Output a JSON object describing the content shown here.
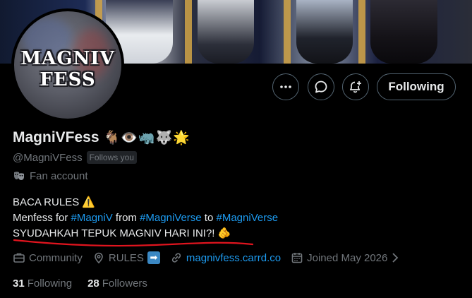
{
  "profile": {
    "avatar_text_line1": "MAGNIV",
    "avatar_text_line2": "FESS",
    "display_name": "MagniVFess",
    "name_emojis": "🐐👁️🦏🐺🌟",
    "handle": "@MagniVFess",
    "follows_you": "Follows you",
    "category": "Fan account",
    "category_icon": "theater-masks-icon"
  },
  "actions": {
    "more_icon": "more-horizontal-icon",
    "message_icon": "message-bubble-icon",
    "notify_icon": "bell-plus-icon",
    "following_label": "Following"
  },
  "bio": {
    "line1_text": "BACA RULES ",
    "line1_emoji": "⚠️",
    "line2_prefix": "Menfess for ",
    "line2_tag1": "#MagniV",
    "line2_mid": " from ",
    "line2_tag2": "#MagniVerse",
    "line2_to": " to ",
    "line2_tag3": "#MagniVerse",
    "line3_text": "SYUDAHKAH TEPUK MAGNIV HARI INI?! ",
    "line3_emoji": "🫵"
  },
  "meta": {
    "community_label": "Community",
    "location_label": "RULES",
    "location_emoji": "➡",
    "website": "magnivfess.carrd.co",
    "joined": "Joined May 2026"
  },
  "stats": {
    "following_count": "31",
    "following_label": "Following",
    "followers_count": "28",
    "followers_label": "Followers"
  },
  "colors": {
    "accent": "#1d9bf0",
    "muted": "#71767b",
    "text": "#e7e9ea",
    "underline": "#e0141e"
  }
}
